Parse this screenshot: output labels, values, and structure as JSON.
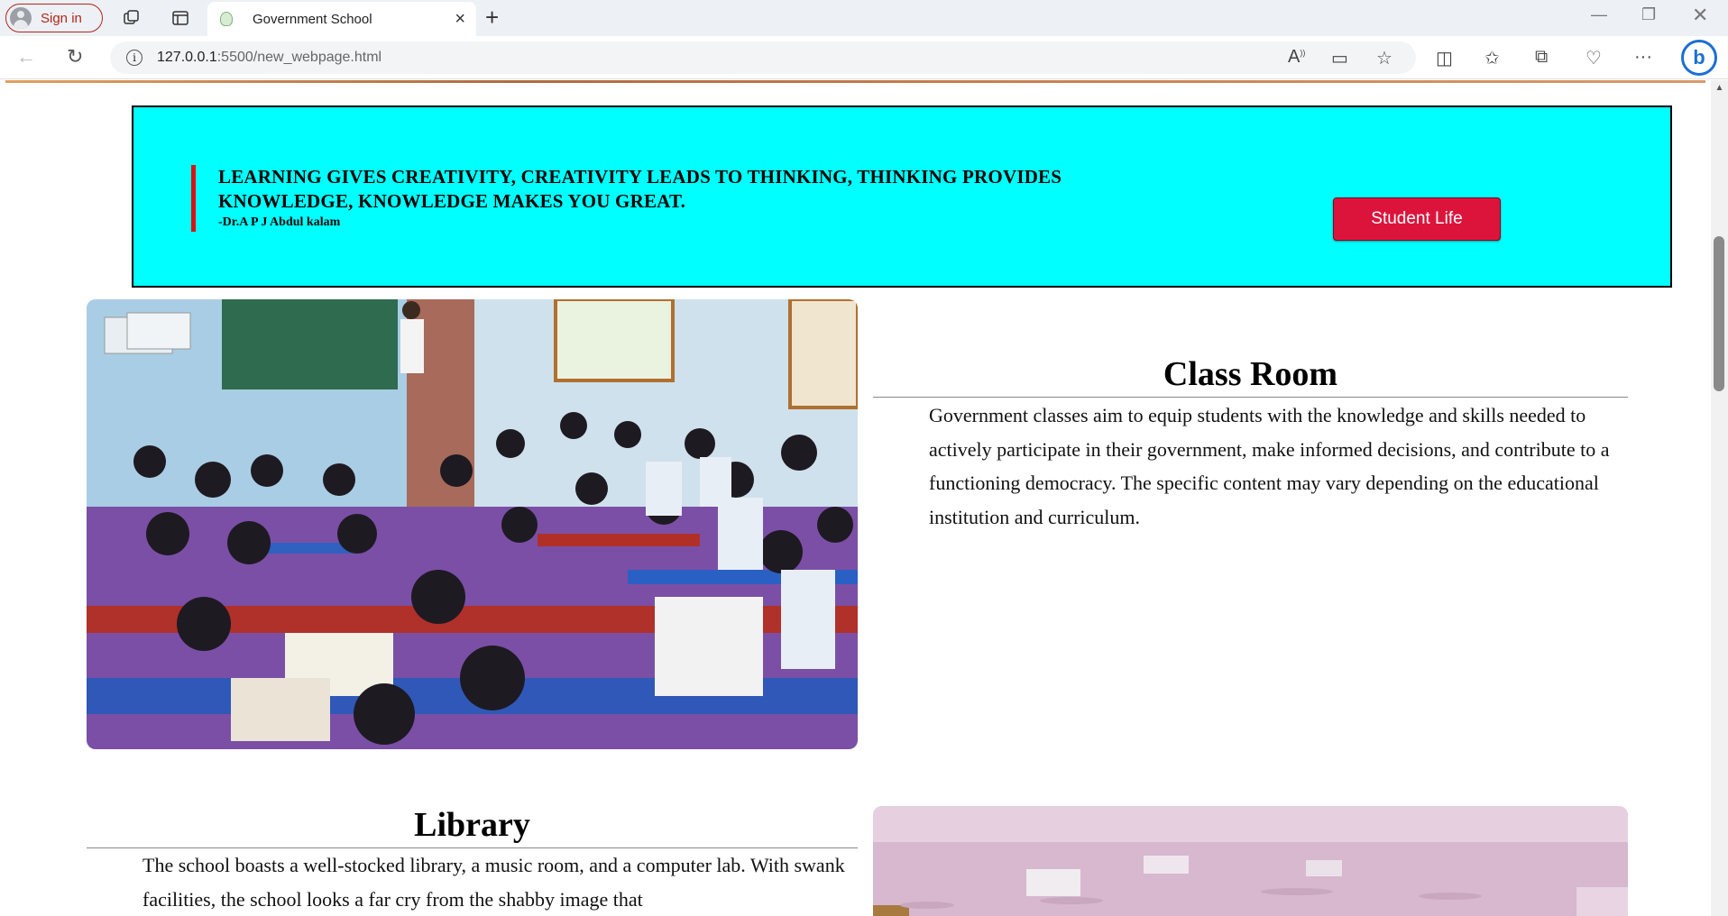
{
  "browser": {
    "signin_label": "Sign in",
    "tab_title": "Government School",
    "url_host": "127.0.0.1",
    "url_path": ":5500/new_webpage.html"
  },
  "quote": {
    "text": "LEARNING GIVES CREATIVITY, CREATIVITY LEADS TO THINKING, THINKING PROVIDES KNOWLEDGE, KNOWLEDGE MAKES YOU GREAT.",
    "author": "-Dr.A P J Abdul kalam",
    "button_label": "Student Life",
    "bg_color": "#00ffff",
    "button_color": "#dc143c"
  },
  "classroom": {
    "title": "Class Room",
    "text": "Government classes aim to equip students with the knowledge and skills needed to actively participate in their government, make informed decisions, and contribute to a functioning democracy. The specific content may vary depending on the educational institution and curriculum."
  },
  "library": {
    "title": "Library",
    "text": "The school boasts a well-stocked library, a music room, and a computer lab. With swank facilities, the school looks a far cry from the shabby image that"
  }
}
